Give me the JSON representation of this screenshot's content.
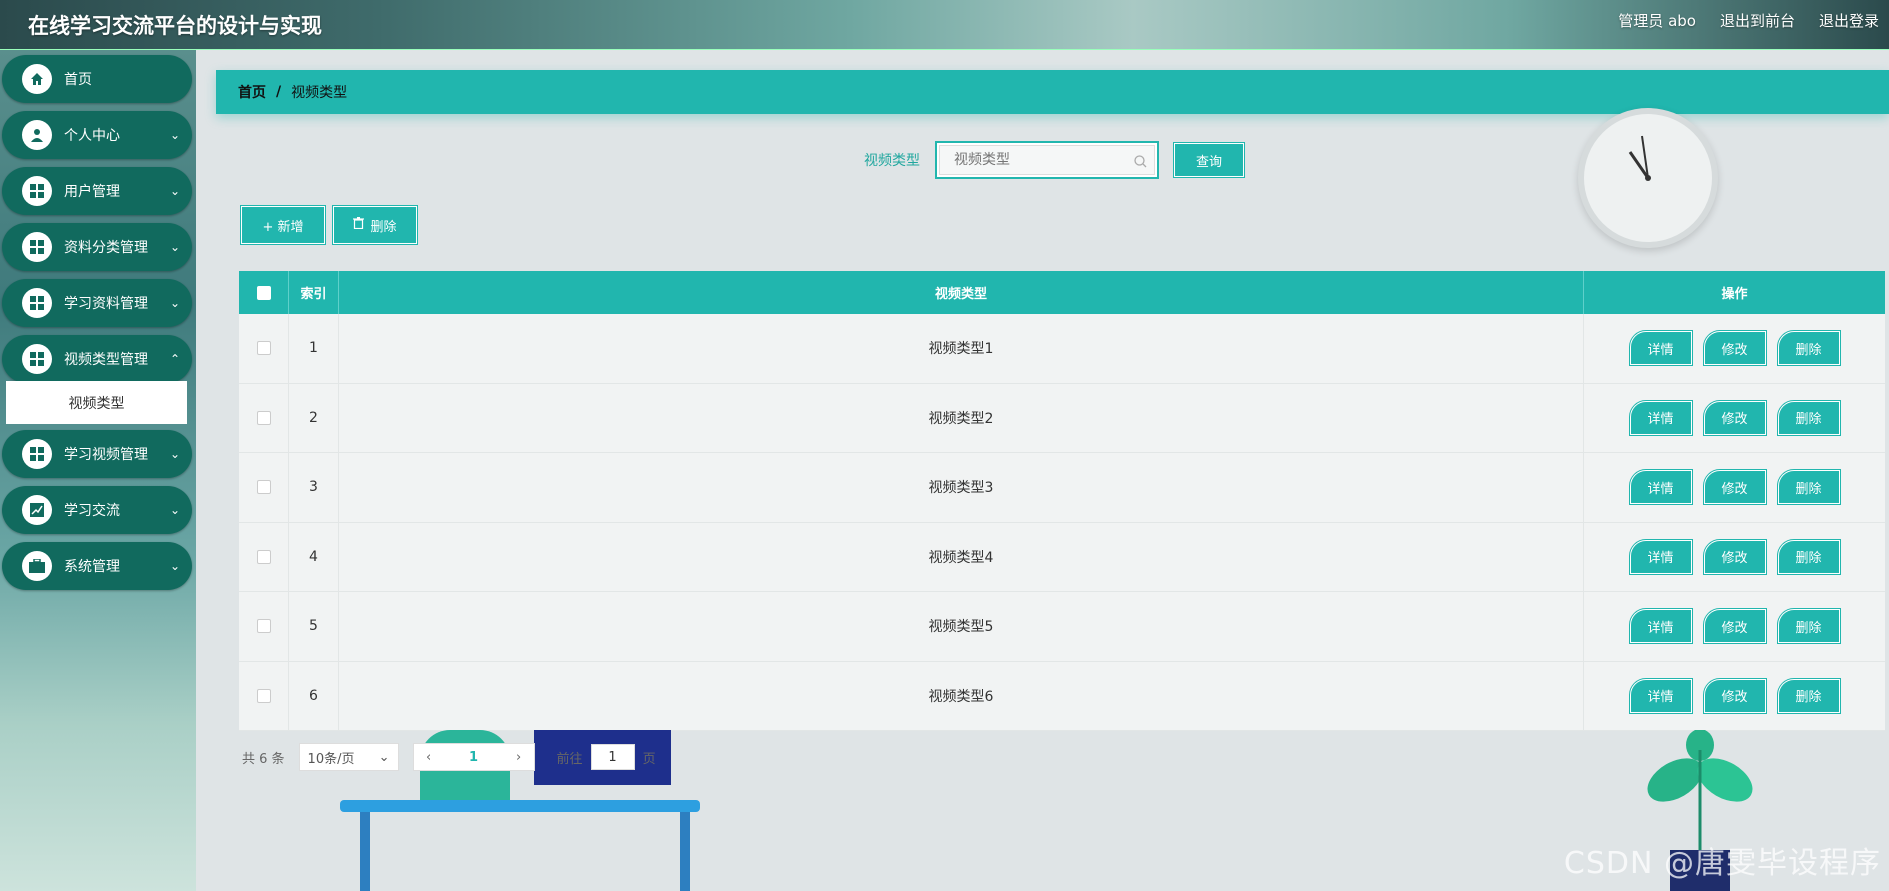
{
  "header": {
    "title": "在线学习交流平台的设计与实现",
    "user_label": "管理员 abo",
    "front_link": "退出到前台",
    "logout_link": "退出登录"
  },
  "sidebar": {
    "items": [
      {
        "label": "首页",
        "icon": "home-icon"
      },
      {
        "label": "个人中心",
        "icon": "user-icon"
      },
      {
        "label": "用户管理",
        "icon": "grid-icon"
      },
      {
        "label": "资料分类管理",
        "icon": "grid-icon"
      },
      {
        "label": "学习资料管理",
        "icon": "grid-icon"
      },
      {
        "label": "视频类型管理",
        "icon": "grid-icon"
      },
      {
        "label": "学习视频管理",
        "icon": "grid-icon"
      },
      {
        "label": "学习交流",
        "icon": "chart-icon"
      },
      {
        "label": "系统管理",
        "icon": "briefcase-icon"
      }
    ],
    "submenu_label": "视频类型"
  },
  "breadcrumb": {
    "home": "首页",
    "separator": "/",
    "current": "视频类型"
  },
  "search": {
    "label": "视频类型",
    "placeholder": "视频类型",
    "button": "查询"
  },
  "toolbar": {
    "add": "+ 新增",
    "delete": "删除"
  },
  "table": {
    "headers": {
      "index": "索引",
      "name": "视频类型",
      "ops": "操作"
    },
    "rows": [
      {
        "index": "1",
        "name": "视频类型1"
      },
      {
        "index": "2",
        "name": "视频类型2"
      },
      {
        "index": "3",
        "name": "视频类型3"
      },
      {
        "index": "4",
        "name": "视频类型4"
      },
      {
        "index": "5",
        "name": "视频类型5"
      },
      {
        "index": "6",
        "name": "视频类型6"
      }
    ],
    "row_actions": {
      "detail": "详情",
      "edit": "修改",
      "delete": "删除"
    }
  },
  "pager": {
    "total": "共 6 条",
    "page_size": "10条/页",
    "current_page": "1",
    "goto_prefix": "前往",
    "goto_value": "1",
    "goto_suffix": "页"
  },
  "watermark": "CSDN @唐雯毕设程序",
  "colors": {
    "accent": "#21b6ae",
    "menu": "#116a5e"
  }
}
